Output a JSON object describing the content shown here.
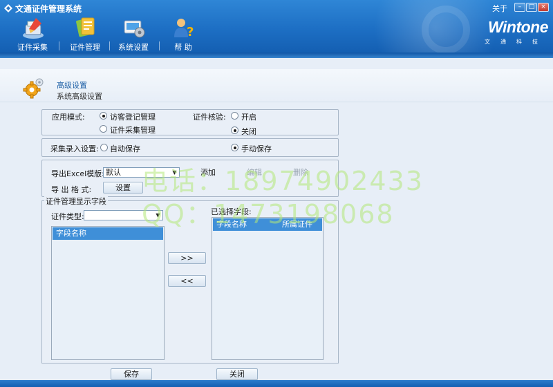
{
  "window": {
    "title": "文通证件管理系统",
    "about": "关于",
    "minimize": "–",
    "maximize": "□",
    "close": "×"
  },
  "nav": {
    "items": [
      {
        "label": "证件采集",
        "icon": "id-capture-icon"
      },
      {
        "label": "证件管理",
        "icon": "id-manage-icon"
      },
      {
        "label": "系统设置",
        "icon": "system-settings-icon"
      },
      {
        "label": "帮 助",
        "icon": "help-icon"
      }
    ]
  },
  "brand": {
    "logo": "Wintone",
    "sub": "文通科技"
  },
  "section": {
    "title": "高级设置",
    "subtitle": "系统高级设置"
  },
  "app_mode": {
    "label": "应用模式:",
    "options": [
      "访客登记管理",
      "证件采集管理"
    ],
    "selected": "访客登记管理"
  },
  "id_verify": {
    "label": "证件核验:",
    "options": [
      "开启",
      "关闭"
    ],
    "selected": "关闭"
  },
  "capture_entry": {
    "label": "采集录入设置:",
    "options": [
      "自动保存",
      "手动保存"
    ],
    "selected": "手动保存"
  },
  "export": {
    "template_label": "导出Excel模版:",
    "template_value": "默认",
    "add": "添加",
    "edit": "编辑",
    "delete": "删除",
    "format_label": "导 出 格 式:",
    "settings": "设置"
  },
  "fields": {
    "legend": "证件管理显示字段",
    "type_label": "证件类型:",
    "type_value": "",
    "selected_label": "已选择字段:",
    "left_header": "字段名称",
    "right_header_name": "字段名称",
    "right_header_cert": "所属证件",
    "add_btn": ">>",
    "remove_btn": "<<"
  },
  "actions": {
    "save": "保存",
    "close": "关闭"
  },
  "watermark": {
    "line1": "电话：18974902433",
    "line2": "QQ：1473198068"
  },
  "colors": {
    "header": "#1d6fc4",
    "accent": "#3f8fd8",
    "panel": "#e9eff7"
  }
}
